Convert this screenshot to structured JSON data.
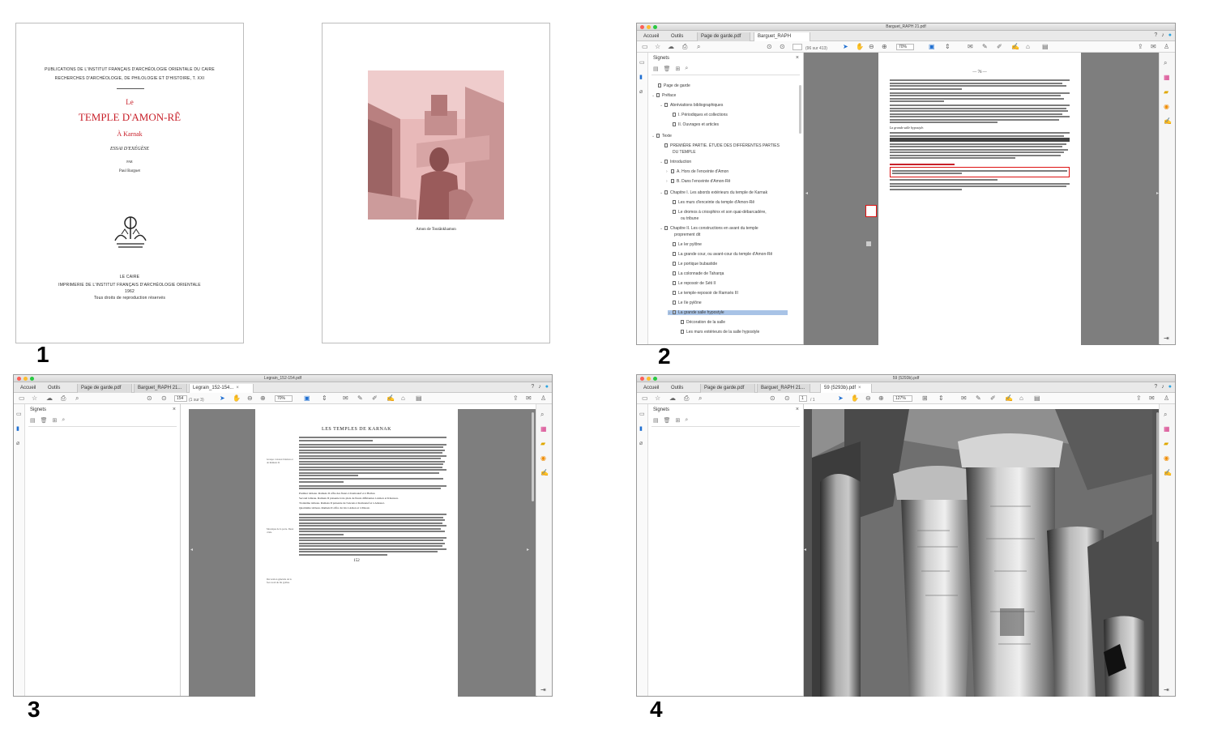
{
  "labels": {
    "n1": "1",
    "n2": "2",
    "n3": "3",
    "n4": "4"
  },
  "panel1": {
    "series_line1": "PUBLICATIONS DE L'INSTITUT FRANÇAIS D'ARCHÉOLOGIE ORIENTALE DU CAIRE",
    "series_line2": "RECHERCHES D'ARCHÉOLOGIE, DE PHILOLOGIE ET D'HISTOIRE, T. XXI",
    "title_le": "Le",
    "title_main": "TEMPLE D'AMON-RÊ",
    "title_place": "À Karnak",
    "subtitle": "ESSAI D'EXÉGÈSE",
    "par": "PAR",
    "author": "Paul Barguet",
    "city": "LE CAIRE",
    "printer": "IMPRIMERIE DE L'INSTITUT FRANÇAIS D'ARCHÉOLOGIE ORIENTALE",
    "year": "1962",
    "rights": "Tous droits de reproduction réservés",
    "caption": "Amon de Toutânkhamon"
  },
  "panel2": {
    "window_title": "Barguet_RAPH 21.pdf",
    "tabs": [
      "Accueil",
      "Outils",
      "Page de garde.pdf",
      "Barguet_RAPH 21..."
    ],
    "page_field": "",
    "page_count": "(96 sur 413)",
    "zoom": "70%",
    "bookmarks_title": "Signets",
    "bookmarks": [
      "Page de garde",
      "Préface",
      "Abréviations bibliographiques",
      "I. Périodiques et collections",
      "II. Ouvrages et articles",
      "Texte",
      "PREMIÈRE PARTIE. ÉTUDE DES DIFFÉRENTES PARTIES",
      "DU TEMPLE",
      "Introduction",
      "A. Hors de l'enceinte d'Amon",
      "B. Dans l'enceinte d'Amon-Rê",
      "Chapitre I. Les abords extérieurs du temple de Karnak",
      "Les murs d'enceinte du temple d'Amon-Rê",
      "Le dromos à criosphinx et son quai-débarcadère,",
      "ou tribune",
      "Chapitre II. Les constructions en avant du temple",
      "proprement dit",
      "Le Ier pylône",
      "La grande cour, ou avant-cour du temple d'Amon-Rê",
      "Le portique bubastide",
      "La colonnade de Taharqa",
      "Le reposoir de Séti II",
      "Le temple-reposoir de Ramsès III",
      "Le IIe pylône",
      "La grande salle hypostyle",
      "Décoration de la salle",
      "Les murs extérieurs de la salle hypostyle"
    ],
    "page_header": "— 76 —",
    "section_heading": "La grande salle hypostyle."
  },
  "panel3": {
    "window_title": "Legrain_152-154.pdf",
    "tabs": [
      "Accueil",
      "Outils",
      "Page de garde.pdf",
      "Barguet_RAPH 21...",
      "Legrain_152-154..."
    ],
    "page_field": "154",
    "page_count": "(1 sur 3)",
    "zoom": "70%",
    "bookmarks_title": "Signets",
    "page_title": "LES TEMPLES DE KARNAK",
    "page_number": "152",
    "margin_notes": [
      "Groupe colossal d'Amon et de Ramsès II.",
      "Mosaïque de la porte. Deux côtés.",
      "Décoration générale de la face nord du IIe pylône."
    ],
    "paragraphs": [
      "Premier tableau. Ramsès II offre des fleurs à Kamoutef et à Hathor.",
      "Second tableau. Ramsès II présente trois plats de fleurs différentes à Amon et Khonsou.",
      "Troisième tableau. Ramsès II présente de l'encens à Kamoutef et à Amonet.",
      "Quatrième tableau. Ramsès II offre du vin à Amon et à Maout."
    ]
  },
  "panel4": {
    "window_title": "59 (5293b).pdf",
    "tabs": [
      "Accueil",
      "Outils",
      "Page de garde.pdf",
      "Barguet_RAPH 21...",
      "59 (5293b).pdf"
    ],
    "page_field": "1",
    "page_count": "/ 1",
    "zoom": "127%",
    "bookmarks_title": "Signets"
  },
  "colors": {
    "accent_blue": "#1f6fd1",
    "title_red": "#c8202a",
    "highlight": "#a8c3e6",
    "viewer_gray": "#7e7e7e"
  }
}
